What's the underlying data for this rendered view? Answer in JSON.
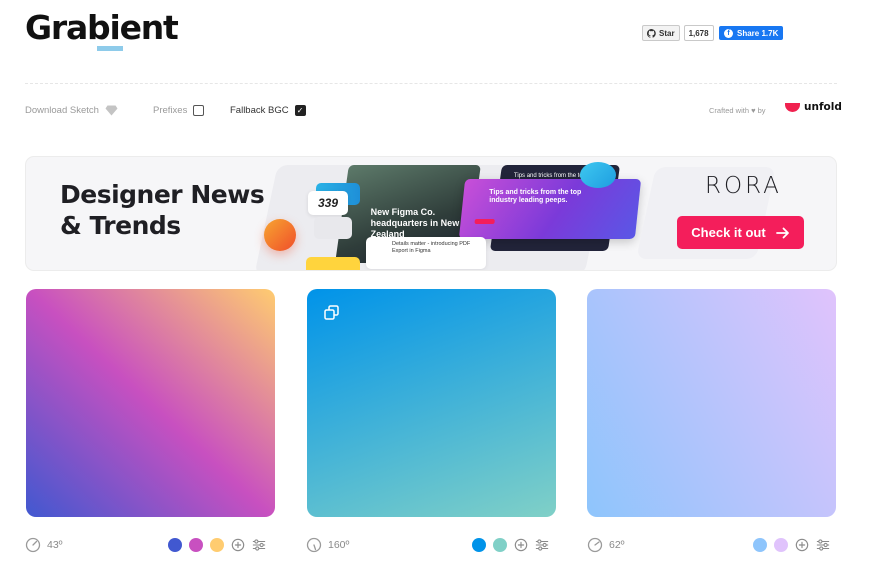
{
  "header": {
    "logo": "Grabient",
    "github": {
      "star_label": "Star",
      "count": "1,678"
    },
    "facebook": {
      "share_label": "Share 1.7K"
    }
  },
  "options": {
    "download_sketch": "Download Sketch",
    "prefixes": "Prefixes",
    "fallback_bgc": "Fallback BGC",
    "fallback_checked": true,
    "prefixes_checked": false,
    "crafted_with": "Crafted with ♥ by",
    "unfold": "unfold"
  },
  "banner": {
    "title_line1": "Designer News",
    "title_line2": "& Trends",
    "brand": "RORA",
    "cta": "Check it out",
    "collage": {
      "card_text": "Tips and tricks from the top industry leading peeps.",
      "figma_text": "New Figma Co. headquarters in New Zealand",
      "number": "339",
      "details_text": "Details matter - introducing PDF Export in Figma",
      "small_headline": "Tips and tricks from the top industry leading peeps."
    }
  },
  "cards": [
    {
      "angle": "43º",
      "colors": [
        "#4158D0",
        "#C850C0",
        "#FFCC70"
      ],
      "gradient_deg": 43
    },
    {
      "angle": "160º",
      "colors": [
        "#0093E9",
        "#80D0C7"
      ],
      "gradient_deg": 160,
      "has_copy_icon": true
    },
    {
      "angle": "62º",
      "colors": [
        "#8EC5FC",
        "#E0C3FC"
      ],
      "gradient_deg": 62
    }
  ],
  "icons": {
    "github": "github-icon",
    "facebook": "facebook-icon",
    "sketch": "diamond-icon",
    "copy": "copy-icon",
    "angle": "angle-dial-icon",
    "add": "plus-circle-icon",
    "settings": "sliders-icon",
    "arrow": "arrow-right-icon"
  }
}
